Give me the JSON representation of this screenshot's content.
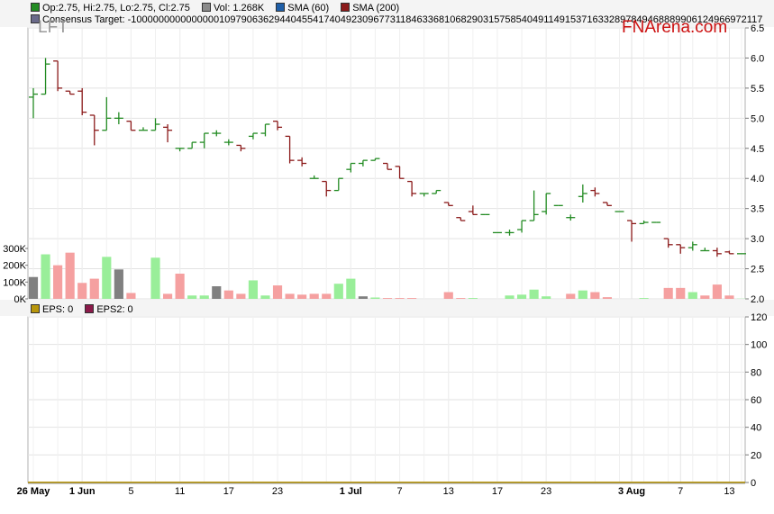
{
  "ticker": "LFT",
  "brand": "FNArena.com",
  "legend": {
    "ohlc": "Op:2.75, Hi:2.75, Lo:2.75, Cl:2.75",
    "vol": "Vol: 1.268K",
    "sma60": "SMA (60)",
    "sma200": "SMA (200)",
    "consensus": "Consensus Target: -1000000000000000109790636294404554174049230967731184633681068290315758540491149153716332897849468889906124966972117"
  },
  "eps_legend": {
    "eps": "EPS: 0",
    "eps2": "EPS2: 0"
  },
  "colors": {
    "up": "#228b22",
    "down": "#8b1a1a",
    "vol_up": "#99ee99",
    "vol_down": "#f5a0a0",
    "vol_flat": "#808080",
    "sma60": "#1f5fa8",
    "sma200": "#8b1a1a",
    "eps_line": "#b8960b"
  },
  "chart_data": [
    {
      "type": "ohlc",
      "title": "LFT",
      "x_tick_labels": [
        "26 May",
        "1 Jun",
        "5",
        "11",
        "17",
        "23",
        "1 Jul",
        "7",
        "13",
        "17",
        "23",
        "3 Aug",
        "7",
        "13"
      ],
      "price_axis": {
        "ticks": [
          "2.0",
          "2.5",
          "3.0",
          "3.5",
          "4.0",
          "4.5",
          "5.0",
          "5.5",
          "6.0",
          "6.5"
        ],
        "ylim": [
          2.0,
          6.5
        ]
      },
      "volume_axis": {
        "ticks": [
          "0K",
          "100K",
          "200K",
          "300K"
        ],
        "ylim": [
          0,
          300000
        ]
      },
      "grid": true,
      "days": [
        {
          "d": "26 May",
          "o": 5.35,
          "h": 5.5,
          "l": 5.0,
          "c": 5.4,
          "v": 130000,
          "vc": "flat"
        },
        {
          "d": "27 May",
          "o": 5.4,
          "h": 6.0,
          "l": 5.4,
          "c": 5.9,
          "v": 265000,
          "vc": "up"
        },
        {
          "d": "28 May",
          "o": 5.95,
          "h": 5.95,
          "l": 5.45,
          "c": 5.5,
          "v": 200000,
          "vc": "down"
        },
        {
          "d": "29 May",
          "o": 5.45,
          "h": 5.45,
          "l": 5.4,
          "c": 5.4,
          "v": 275000,
          "vc": "down"
        },
        {
          "d": "1 Jun",
          "o": 5.45,
          "h": 5.5,
          "l": 5.05,
          "c": 5.1,
          "v": 95000,
          "vc": "down"
        },
        {
          "d": "2 Jun",
          "o": 5.05,
          "h": 5.05,
          "l": 4.55,
          "c": 4.8,
          "v": 120000,
          "vc": "down"
        },
        {
          "d": "3 Jun",
          "o": 4.8,
          "h": 5.35,
          "l": 4.8,
          "c": 5.0,
          "v": 250000,
          "vc": "up"
        },
        {
          "d": "4 Jun",
          "o": 5.0,
          "h": 5.1,
          "l": 4.9,
          "c": 5.0,
          "v": 175000,
          "vc": "flat"
        },
        {
          "d": "5 Jun",
          "o": 4.95,
          "h": 4.95,
          "l": 4.8,
          "c": 4.8,
          "v": 35000,
          "vc": "down"
        },
        {
          "d": "8 Jun",
          "o": 4.8,
          "h": 4.85,
          "l": 4.8,
          "c": 4.8,
          "v": 0,
          "vc": "up"
        },
        {
          "d": "9 Jun",
          "o": 4.8,
          "h": 5.0,
          "l": 4.8,
          "c": 4.9,
          "v": 245000,
          "vc": "up"
        },
        {
          "d": "10 Jun",
          "o": 4.85,
          "h": 4.9,
          "l": 4.6,
          "c": 4.8,
          "v": 30000,
          "vc": "down"
        },
        {
          "d": "11 Jun",
          "o": 4.5,
          "h": 4.5,
          "l": 4.45,
          "c": 4.5,
          "v": 150000,
          "vc": "down"
        },
        {
          "d": "12 Jun",
          "o": 4.5,
          "h": 4.6,
          "l": 4.5,
          "c": 4.6,
          "v": 20000,
          "vc": "up"
        },
        {
          "d": "15 Jun",
          "o": 4.6,
          "h": 4.75,
          "l": 4.5,
          "c": 4.75,
          "v": 20000,
          "vc": "up"
        },
        {
          "d": "16 Jun",
          "o": 4.75,
          "h": 4.8,
          "l": 4.7,
          "c": 4.75,
          "v": 75000,
          "vc": "flat"
        },
        {
          "d": "17 Jun",
          "o": 4.6,
          "h": 4.65,
          "l": 4.55,
          "c": 4.6,
          "v": 50000,
          "vc": "down"
        },
        {
          "d": "18 Jun",
          "o": 4.55,
          "h": 4.55,
          "l": 4.45,
          "c": 4.5,
          "v": 30000,
          "vc": "down"
        },
        {
          "d": "19 Jun",
          "o": 4.7,
          "h": 4.75,
          "l": 4.65,
          "c": 4.75,
          "v": 110000,
          "vc": "up"
        },
        {
          "d": "22 Jun",
          "o": 4.75,
          "h": 4.9,
          "l": 4.7,
          "c": 4.9,
          "v": 20000,
          "vc": "up"
        },
        {
          "d": "23 Jun",
          "o": 4.95,
          "h": 4.95,
          "l": 4.8,
          "c": 4.85,
          "v": 80000,
          "vc": "down"
        },
        {
          "d": "24 Jun",
          "o": 4.7,
          "h": 4.7,
          "l": 4.25,
          "c": 4.3,
          "v": 30000,
          "vc": "down"
        },
        {
          "d": "25 Jun",
          "o": 4.3,
          "h": 4.35,
          "l": 4.2,
          "c": 4.25,
          "v": 25000,
          "vc": "down"
        },
        {
          "d": "26 Jun",
          "o": 4.0,
          "h": 4.05,
          "l": 4.0,
          "c": 4.0,
          "v": 30000,
          "vc": "down"
        },
        {
          "d": "29 Jun",
          "o": 3.95,
          "h": 3.95,
          "l": 3.7,
          "c": 3.8,
          "v": 30000,
          "vc": "down"
        },
        {
          "d": "30 Jun",
          "o": 3.8,
          "h": 4.0,
          "l": 3.8,
          "c": 4.0,
          "v": 90000,
          "vc": "up"
        },
        {
          "d": "1 Jul",
          "o": 4.15,
          "h": 4.25,
          "l": 4.1,
          "c": 4.25,
          "v": 120000,
          "vc": "up"
        },
        {
          "d": "2 Jul",
          "o": 4.25,
          "h": 4.3,
          "l": 4.2,
          "c": 4.3,
          "v": 15000,
          "vc": "flat"
        },
        {
          "d": "3 Jul",
          "o": 4.3,
          "h": 4.33,
          "l": 4.3,
          "c": 4.33,
          "v": 8000,
          "vc": "up"
        },
        {
          "d": "6 Jul",
          "o": 4.25,
          "h": 4.25,
          "l": 4.15,
          "c": 4.15,
          "v": 5000,
          "vc": "down"
        },
        {
          "d": "7 Jul",
          "o": 4.2,
          "h": 4.2,
          "l": 4.0,
          "c": 4.0,
          "v": 5000,
          "vc": "down"
        },
        {
          "d": "8 Jul",
          "o": 3.95,
          "h": 3.95,
          "l": 3.7,
          "c": 3.75,
          "v": 5000,
          "vc": "down"
        },
        {
          "d": "9 Jul",
          "o": 3.75,
          "h": 3.75,
          "l": 3.7,
          "c": 3.75,
          "v": 0,
          "vc": "down"
        },
        {
          "d": "10 Jul",
          "o": 3.75,
          "h": 3.8,
          "l": 3.75,
          "c": 3.8,
          "v": 0,
          "vc": "up"
        },
        {
          "d": "13 Jul",
          "o": 3.6,
          "h": 3.6,
          "l": 3.55,
          "c": 3.55,
          "v": 40000,
          "vc": "down"
        },
        {
          "d": "14 Jul",
          "o": 3.35,
          "h": 3.35,
          "l": 3.3,
          "c": 3.3,
          "v": 5000,
          "vc": "down"
        },
        {
          "d": "15 Jul",
          "o": 3.45,
          "h": 3.55,
          "l": 3.4,
          "c": 3.4,
          "v": 5000,
          "vc": "up"
        },
        {
          "d": "16 Jul",
          "o": 3.4,
          "h": 3.4,
          "l": 3.4,
          "c": 3.4,
          "v": 0,
          "vc": "up"
        },
        {
          "d": "17 Jul",
          "o": 3.1,
          "h": 3.1,
          "l": 3.1,
          "c": 3.1,
          "v": 0,
          "vc": "down"
        },
        {
          "d": "20 Jul",
          "o": 3.1,
          "h": 3.15,
          "l": 3.05,
          "c": 3.1,
          "v": 20000,
          "vc": "up"
        },
        {
          "d": "21 Jul",
          "o": 3.15,
          "h": 3.3,
          "l": 3.1,
          "c": 3.3,
          "v": 25000,
          "vc": "up"
        },
        {
          "d": "22 Jul",
          "o": 3.3,
          "h": 3.8,
          "l": 3.3,
          "c": 3.4,
          "v": 55000,
          "vc": "up"
        },
        {
          "d": "23 Jul",
          "o": 3.45,
          "h": 3.75,
          "l": 3.4,
          "c": 3.75,
          "v": 15000,
          "vc": "up"
        },
        {
          "d": "24 Jul",
          "o": 3.55,
          "h": 3.55,
          "l": 3.55,
          "c": 3.55,
          "v": 0,
          "vc": "down"
        },
        {
          "d": "27 Jul",
          "o": 3.35,
          "h": 3.4,
          "l": 3.3,
          "c": 3.35,
          "v": 30000,
          "vc": "down"
        },
        {
          "d": "28 Jul",
          "o": 3.7,
          "h": 3.9,
          "l": 3.6,
          "c": 3.75,
          "v": 50000,
          "vc": "up"
        },
        {
          "d": "29 Jul",
          "o": 3.8,
          "h": 3.85,
          "l": 3.7,
          "c": 3.75,
          "v": 40000,
          "vc": "down"
        },
        {
          "d": "30 Jul",
          "o": 3.6,
          "h": 3.6,
          "l": 3.55,
          "c": 3.55,
          "v": 10000,
          "vc": "down"
        },
        {
          "d": "31 Jul",
          "o": 3.45,
          "h": 3.45,
          "l": 3.45,
          "c": 3.45,
          "v": 0,
          "vc": "down"
        },
        {
          "d": "3 Aug",
          "o": 3.3,
          "h": 3.3,
          "l": 2.95,
          "c": 3.25,
          "v": 0,
          "vc": "down"
        },
        {
          "d": "4 Aug",
          "o": 3.25,
          "h": 3.3,
          "l": 3.25,
          "c": 3.27,
          "v": 5000,
          "vc": "up"
        },
        {
          "d": "5 Aug",
          "o": 3.27,
          "h": 3.27,
          "l": 3.27,
          "c": 3.27,
          "v": 0,
          "vc": "up"
        },
        {
          "d": "6 Aug",
          "o": 3.0,
          "h": 3.0,
          "l": 2.85,
          "c": 2.9,
          "v": 65000,
          "vc": "down"
        },
        {
          "d": "7 Aug",
          "o": 2.9,
          "h": 2.9,
          "l": 2.75,
          "c": 2.85,
          "v": 65000,
          "vc": "down"
        },
        {
          "d": "10 Aug",
          "o": 2.85,
          "h": 2.95,
          "l": 2.8,
          "c": 2.9,
          "v": 40000,
          "vc": "up"
        },
        {
          "d": "11 Aug",
          "o": 2.8,
          "h": 2.85,
          "l": 2.8,
          "c": 2.8,
          "v": 20000,
          "vc": "down"
        },
        {
          "d": "12 Aug",
          "o": 2.8,
          "h": 2.85,
          "l": 2.7,
          "c": 2.75,
          "v": 85000,
          "vc": "down"
        },
        {
          "d": "13 Aug",
          "o": 2.78,
          "h": 2.8,
          "l": 2.75,
          "c": 2.75,
          "v": 20000,
          "vc": "down"
        },
        {
          "d": "14 Aug",
          "o": 2.75,
          "h": 2.75,
          "l": 2.75,
          "c": 2.75,
          "v": 1268,
          "vc": "up"
        }
      ]
    },
    {
      "type": "line",
      "series": [
        {
          "name": "EPS: 0",
          "value": 0
        },
        {
          "name": "EPS2: 0",
          "value": 0
        }
      ],
      "y_axis": {
        "ticks": [
          "0",
          "20",
          "40",
          "60",
          "80",
          "100",
          "120"
        ],
        "ylim": [
          0,
          120
        ]
      },
      "grid": true
    }
  ]
}
